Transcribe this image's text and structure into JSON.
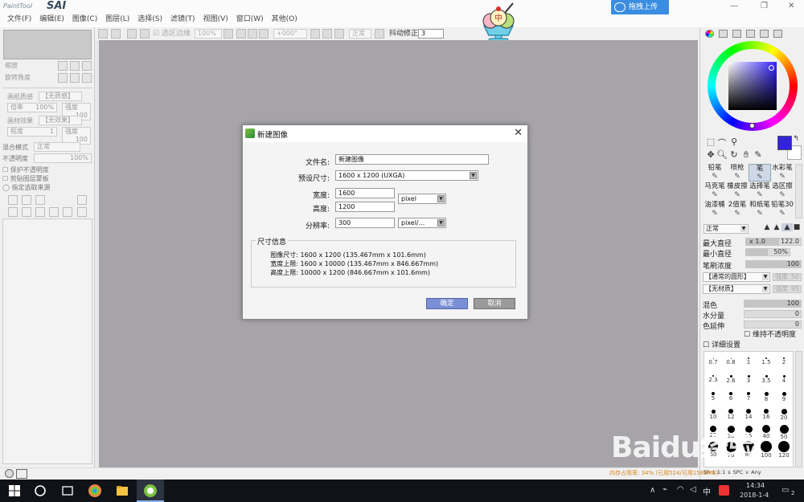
{
  "app": {
    "logo_small": "PaintTool",
    "logo_big": "SAI",
    "menus": [
      "文件(F)",
      "编辑(E)",
      "图像(C)",
      "图层(L)",
      "选择(S)",
      "滤镜(T)",
      "视图(V)",
      "窗口(W)",
      "其他(O)"
    ],
    "upload_label": "拖拽上传",
    "mascot_char": "中"
  },
  "toolbar": {
    "select_outline_label": "选区边缘",
    "zoom": "100%",
    "angle": "+000°",
    "mode": "正常",
    "stabilizer_label": "抖动修正",
    "stabilizer_value": "3"
  },
  "left_panel": {
    "zoom_label": "缩放",
    "angle_label": "旋转角度",
    "paper_texture_label": "画纸质感",
    "paper_texture_value": "【无质感】",
    "rate_label": "倍率",
    "rate_value": "100%",
    "strength_label": "强度",
    "strength_value": "100",
    "effect_label": "画材效果",
    "effect_value": "【无效果】",
    "width_label": "程度",
    "width_value": "1",
    "strength2_label": "强度",
    "strength2_value": "100",
    "blend_label": "混合模式",
    "blend_value": "正常",
    "opacity_label": "不透明度",
    "opacity_value": "100%",
    "check1": "保护不透明度",
    "check2": "剪贴图层蒙板",
    "check3": "指定选取来源"
  },
  "right_panel": {
    "brushes": [
      {
        "name": "铅笔",
        "sel": false
      },
      {
        "name": "喷枪",
        "sel": false
      },
      {
        "name": "笔",
        "sel": true
      },
      {
        "name": "水彩笔",
        "sel": false
      },
      {
        "name": "马克笔",
        "sel": false
      },
      {
        "name": "橡皮擦",
        "sel": false
      },
      {
        "name": "选择笔",
        "sel": false
      },
      {
        "name": "选区擦",
        "sel": false
      },
      {
        "name": "油漆桶",
        "sel": false
      },
      {
        "name": "2值笔",
        "sel": false
      },
      {
        "name": "和纸笔",
        "sel": false
      },
      {
        "name": "铅笔30",
        "sel": false
      }
    ],
    "blend_mode": "正常",
    "max_size_label": "最大直径",
    "max_size_mult": "x 1.0",
    "max_size_value": "122.0",
    "min_size_label": "最小直径",
    "min_size_value": "50%",
    "density_label": "笔刷浓度",
    "density_value": "100",
    "shape_value": "【通常的圆形】",
    "shape_strength_label": "强度",
    "shape_strength_value": "50",
    "texture_value": "【无材质】",
    "texture_strength_label": "强度",
    "texture_strength_value": "95",
    "blend_label": "混色",
    "blend_value": "100",
    "water_label": "水分量",
    "water_value": "0",
    "persist_label": "色延伸",
    "persist_value": "0",
    "keep_opacity_label": "维持不透明度",
    "detail_label": "详细设置",
    "dot_sizes": [
      "0.7",
      "0.8",
      "1",
      "1.5",
      "2",
      "2.3",
      "2.6",
      "3",
      "3.5",
      "4",
      "5",
      "6",
      "7",
      "8",
      "9",
      "10",
      "12",
      "14",
      "16",
      "20",
      "25",
      "30",
      "35",
      "40",
      "50",
      "60",
      "70",
      "80",
      "100",
      "120"
    ],
    "bottom_labels": [
      "Sh",
      "t",
      "1:1",
      "s",
      "SPC",
      "v",
      "Any"
    ]
  },
  "dialog": {
    "title": "新建图像",
    "filename_label": "文件名:",
    "filename_value": "新建图像",
    "preset_label": "预设尺寸:",
    "preset_value": "1600 x 1200 (UXGA)",
    "width_label": "宽度:",
    "width_value": "1600",
    "height_label": "高度:",
    "height_value": "1200",
    "unit_value": "pixel",
    "resolution_label": "分辨率:",
    "resolution_value": "300",
    "res_unit_value": "pixel/...",
    "group_title": "尺寸信息",
    "info": [
      {
        "k": "图像尺寸:",
        "v": "1600 x 1200 (135.467mm x 101.6mm)"
      },
      {
        "k": "宽度上限:",
        "v": "1600 x 10000 (135.467mm x 846.667mm)"
      },
      {
        "k": "高度上限:",
        "v": "10000 x 1200 (846.667mm x 101.6mm)"
      }
    ],
    "ok_label": "确定",
    "cancel_label": "取消"
  },
  "statusbar": {
    "notice": "内存占用率: 34% (已用524/可用1589MB)"
  },
  "taskbar": {
    "time": "14:34",
    "date": "2018-1-4",
    "ime": "中",
    "badge": "2"
  },
  "watermark": "Baidu经验"
}
